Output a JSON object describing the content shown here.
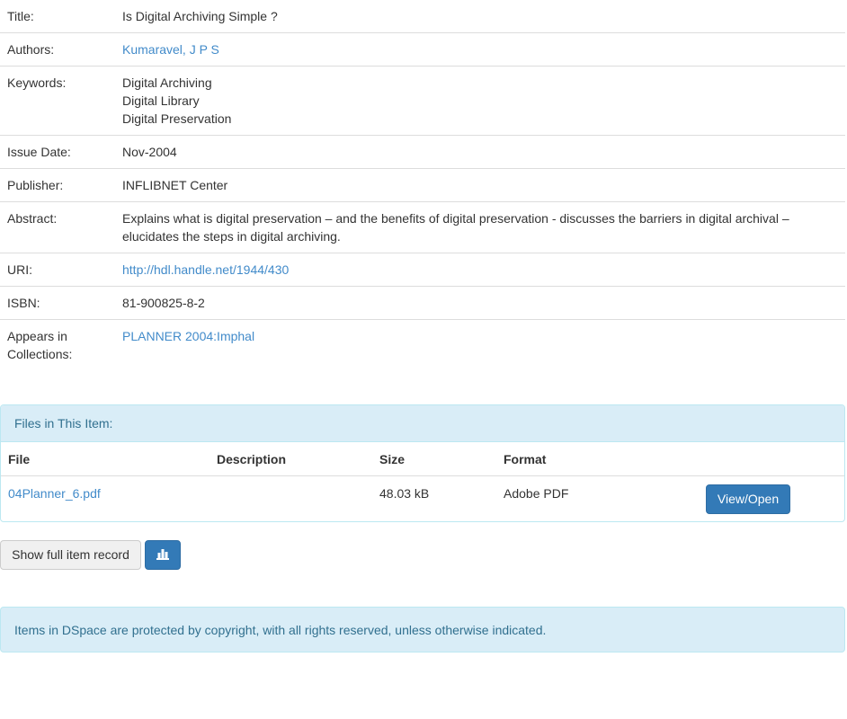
{
  "metadata": {
    "title_label": "Title:",
    "title_value": "Is Digital Archiving Simple ?",
    "authors_label": "Authors:",
    "authors_value": "Kumaravel, J P S",
    "keywords_label": "Keywords:",
    "keywords": [
      "Digital Archiving",
      "Digital Library",
      "Digital Preservation"
    ],
    "issue_date_label": "Issue Date:",
    "issue_date_value": "Nov-2004",
    "publisher_label": "Publisher:",
    "publisher_value": "INFLIBNET Center",
    "abstract_label": "Abstract:",
    "abstract_line1": "Explains what is digital preservation – and the benefits of digital preservation - discusses the barriers in digital archival –",
    "abstract_line2": "elucidates the steps in digital archiving.",
    "uri_label": "URI:",
    "uri_value": "http://hdl.handle.net/1944/430",
    "isbn_label": "ISBN:",
    "isbn_value": "81-900825-8-2",
    "collections_label_line1": "Appears in",
    "collections_label_line2": "Collections:",
    "collections_value": "PLANNER 2004:Imphal"
  },
  "files": {
    "heading": "Files in This Item:",
    "columns": {
      "file": "File",
      "description": "Description",
      "size": "Size",
      "format": "Format"
    },
    "rows": [
      {
        "file": "04Planner_6.pdf",
        "description": "",
        "size": "48.03 kB",
        "format": "Adobe PDF",
        "action": "View/Open"
      }
    ]
  },
  "buttons": {
    "full_record": "Show full item record",
    "stats_icon": "bar-chart-icon"
  },
  "footer": {
    "copyright": "Items in DSpace are protected by copyright, with all rights reserved, unless otherwise indicated."
  },
  "colors": {
    "link": "#428bca",
    "primary": "#337ab7",
    "info_bg": "#d9edf7",
    "info_text": "#31708f"
  }
}
